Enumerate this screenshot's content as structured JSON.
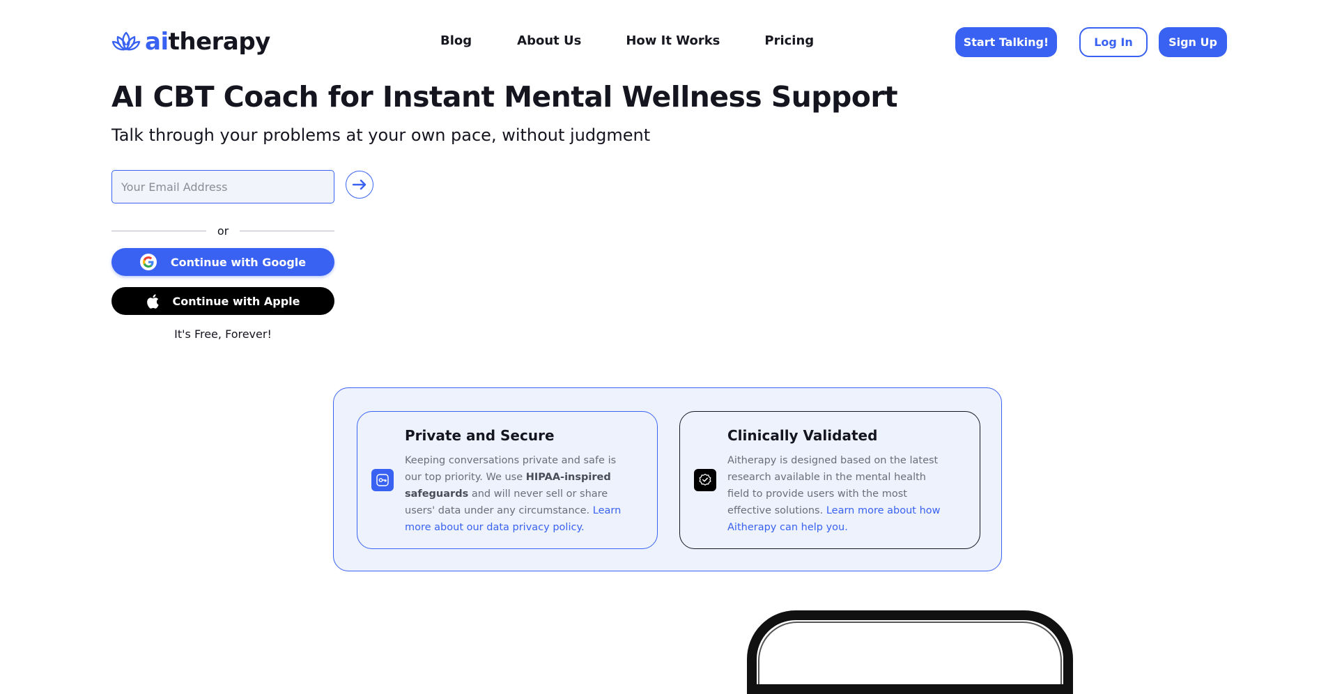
{
  "header": {
    "logo": {
      "prefix": "ai",
      "suffix": "therapy"
    },
    "nav": [
      "Blog",
      "About Us",
      "How It Works",
      "Pricing"
    ],
    "start_label": "Start Talking!",
    "login_label": "Log In",
    "signup_label": "Sign Up"
  },
  "hero": {
    "title": "AI CBT Coach for Instant Mental Wellness Support",
    "subtitle": "Talk through your problems at your own pace, without judgment",
    "email_placeholder": "Your Email Address",
    "email_value": "",
    "or_text": "or",
    "google_label": "Continue with Google",
    "apple_label": "Continue with Apple",
    "free_text": "It's Free, Forever!"
  },
  "features": [
    {
      "title": "Private and Secure",
      "icon": "key-icon",
      "text_before": "Keeping conversations private and safe is our top priority. We use ",
      "bold": "HIPAA-inspired safeguards",
      "text_after": " and will never sell or share users' data under any circumstance. ",
      "link": "Learn more about our data privacy policy."
    },
    {
      "title": "Clinically Validated",
      "icon": "check-badge-icon",
      "text_before": "Aitherapy is designed based on the latest research available in the mental health field to provide users with the most effective solutions. ",
      "link": "Learn more about how Aitherapy can help you."
    }
  ],
  "colors": {
    "accent": "#3a62f2",
    "text": "#14151f",
    "muted": "#6b6e79",
    "panel": "#edf2fc"
  }
}
